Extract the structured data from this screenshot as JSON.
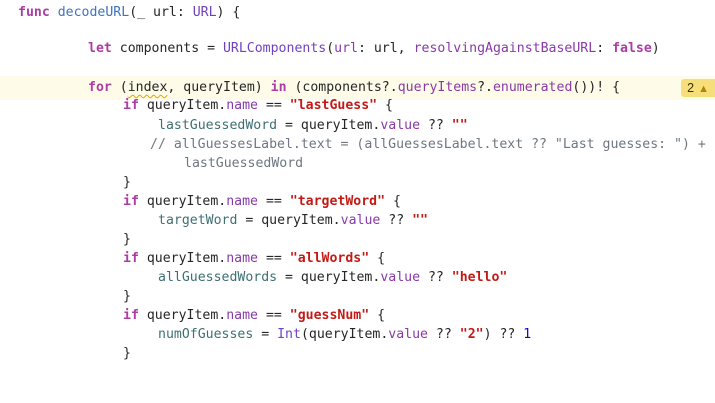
{
  "editor": {
    "warning_count": "2",
    "warning_icon": "warning-triangle-icon",
    "lines": [
      {
        "tokens": [
          {
            "t": "func",
            "c": "kw"
          },
          {
            "t": " "
          },
          {
            "t": "decodeURL",
            "c": "fn"
          },
          {
            "t": "(_ url: "
          },
          {
            "t": "URL",
            "c": "type"
          },
          {
            "t": ") {"
          }
        ]
      },
      {
        "tokens": [
          {
            "t": "let",
            "c": "kw"
          },
          {
            "t": " components = "
          },
          {
            "t": "URLComponents",
            "c": "type"
          },
          {
            "t": "("
          },
          {
            "t": "url",
            "c": "mem"
          },
          {
            "t": ": url, "
          },
          {
            "t": "resolvingAgainstBaseURL",
            "c": "mem"
          },
          {
            "t": ": "
          },
          {
            "t": "false",
            "c": "kw"
          },
          {
            "t": ")"
          }
        ]
      },
      {
        "tokens": [
          {
            "t": "for",
            "c": "kw"
          },
          {
            "t": " ("
          },
          {
            "t": "index",
            "c": "squig"
          },
          {
            "t": ", queryItem) "
          },
          {
            "t": "in",
            "c": "kw"
          },
          {
            "t": " (components?."
          },
          {
            "t": "queryItems",
            "c": "mem"
          },
          {
            "t": "?."
          },
          {
            "t": "enumerated",
            "c": "mem"
          },
          {
            "t": "())! {"
          }
        ]
      },
      {
        "tokens": [
          {
            "t": "if",
            "c": "kw"
          },
          {
            "t": " queryItem."
          },
          {
            "t": "name",
            "c": "mem"
          },
          {
            "t": " == "
          },
          {
            "t": "\"lastGuess\"",
            "c": "str"
          },
          {
            "t": " {"
          }
        ]
      },
      {
        "tokens": [
          {
            "t": "lastGuessedWord",
            "c": "prop"
          },
          {
            "t": " = queryItem."
          },
          {
            "t": "value",
            "c": "mem"
          },
          {
            "t": " ?? "
          },
          {
            "t": "\"\"",
            "c": "str"
          }
        ]
      },
      {
        "tokens": [
          {
            "t": "// allGuessesLabel.text = (allGuessesLabel.text ?? \"Last guesses: \") +",
            "c": "cmt"
          }
        ]
      },
      {
        "tokens": [
          {
            "t": "lastGuessedWord",
            "c": "cmt"
          }
        ]
      },
      {
        "tokens": [
          {
            "t": "}"
          }
        ]
      },
      {
        "tokens": [
          {
            "t": "if",
            "c": "kw"
          },
          {
            "t": " queryItem."
          },
          {
            "t": "name",
            "c": "mem"
          },
          {
            "t": " == "
          },
          {
            "t": "\"targetWord\"",
            "c": "str"
          },
          {
            "t": " {"
          }
        ]
      },
      {
        "tokens": [
          {
            "t": "targetWord",
            "c": "prop"
          },
          {
            "t": " = queryItem."
          },
          {
            "t": "value",
            "c": "mem"
          },
          {
            "t": " ?? "
          },
          {
            "t": "\"\"",
            "c": "str"
          }
        ]
      },
      {
        "tokens": [
          {
            "t": "}"
          }
        ]
      },
      {
        "tokens": [
          {
            "t": "if",
            "c": "kw"
          },
          {
            "t": " queryItem."
          },
          {
            "t": "name",
            "c": "mem"
          },
          {
            "t": " == "
          },
          {
            "t": "\"allWords\"",
            "c": "str"
          },
          {
            "t": " {"
          }
        ]
      },
      {
        "tokens": [
          {
            "t": "allGuessedWords",
            "c": "prop"
          },
          {
            "t": " = queryItem."
          },
          {
            "t": "value",
            "c": "mem"
          },
          {
            "t": " ?? "
          },
          {
            "t": "\"hello\"",
            "c": "str"
          }
        ]
      },
      {
        "tokens": [
          {
            "t": "}"
          }
        ]
      },
      {
        "tokens": [
          {
            "t": "if",
            "c": "kw"
          },
          {
            "t": " queryItem."
          },
          {
            "t": "name",
            "c": "mem"
          },
          {
            "t": " == "
          },
          {
            "t": "\"guessNum\"",
            "c": "str"
          },
          {
            "t": " {"
          }
        ]
      },
      {
        "tokens": [
          {
            "t": "numOfGuesses",
            "c": "prop"
          },
          {
            "t": " = "
          },
          {
            "t": "Int",
            "c": "type"
          },
          {
            "t": "(queryItem."
          },
          {
            "t": "value",
            "c": "mem"
          },
          {
            "t": " ?? "
          },
          {
            "t": "\"2\"",
            "c": "str"
          },
          {
            "t": ") ?? "
          },
          {
            "t": "1",
            "c": "num"
          }
        ]
      },
      {
        "tokens": [
          {
            "t": "}"
          }
        ]
      }
    ]
  }
}
